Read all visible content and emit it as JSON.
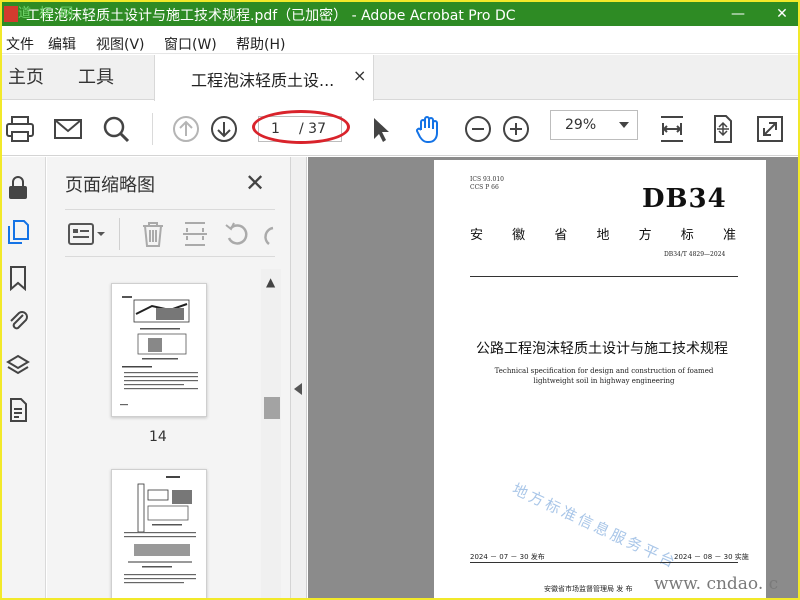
{
  "window": {
    "title": "工程泡沫轻质土设计与施工技术规程.pdf（已加密） - Adobe Acrobat Pro DC",
    "watermark": "道  标  网",
    "controls": [
      "—",
      "✕"
    ]
  },
  "menu": {
    "items": [
      "文件",
      "编辑",
      "视图(V)",
      "窗口(W)",
      "帮助(H)"
    ]
  },
  "tabs": {
    "home": "主页",
    "tools": "工具",
    "doc_tab": "工程泡沫轻质土设...",
    "close": "×"
  },
  "toolbar": {
    "page_current": "1",
    "page_total": "/ 37",
    "zoom": "29%"
  },
  "panel": {
    "title": "页面缩略图",
    "close": "✕",
    "thumb_label": "14"
  },
  "document": {
    "ics": "ICS  93.010",
    "ccs": "CCS  P 66",
    "std_code": "DB34",
    "province_chars": [
      "安",
      "徽",
      "省",
      "地",
      "方",
      "标",
      "准"
    ],
    "std_number": "DB34/T  4829—2024",
    "cn_title": "公路工程泡沫轻质土设计与施工技术规程",
    "en_title": "Technical specification for design and construction of foamed lightweight soil in highway engineering",
    "watermark": "地方标准信息服务平台",
    "publish_date": "2024 － 07 － 30 发布",
    "implement_date": "2024 － 08 － 30 实施",
    "issuer": "安徽省市场监督管理局    发 布"
  },
  "site_watermark": "www. cndao. c",
  "colors": {
    "title_bar": "#2e8b24",
    "accent_blue": "#1473e6",
    "highlight_ellipse": "#d9232b",
    "outer_border": "#fbf72f"
  }
}
